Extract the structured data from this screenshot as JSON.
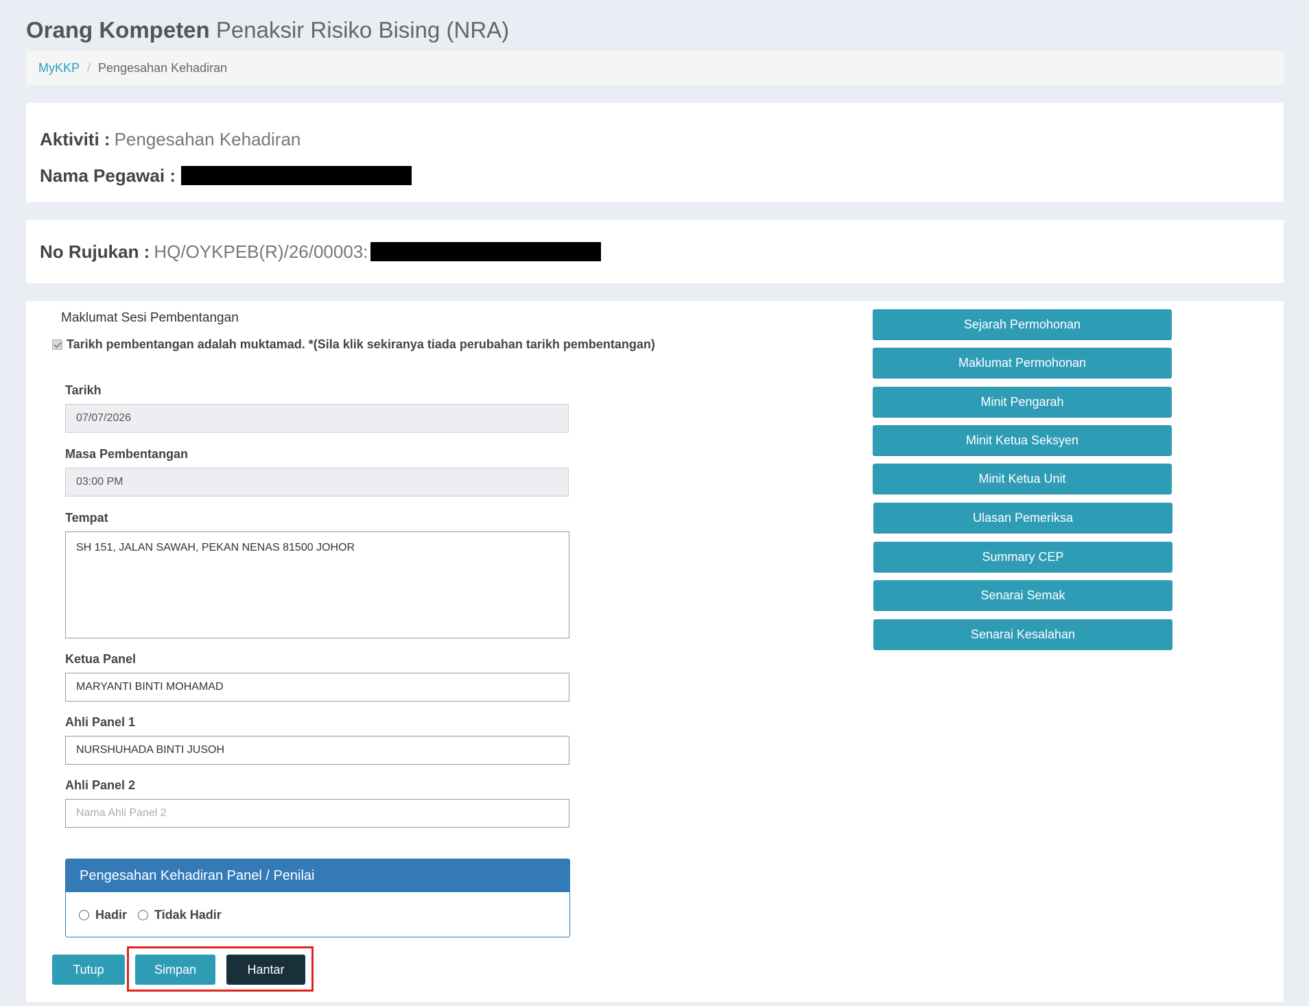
{
  "page": {
    "title_strong": "Orang Kompeten",
    "title_light": "Penaksir Risiko Bising (NRA)"
  },
  "breadcrumb": {
    "home": "MyKKP",
    "separator": "/",
    "current": "Pengesahan Kehadiran"
  },
  "activity": {
    "label": "Aktiviti :",
    "value": "Pengesahan Kehadiran",
    "officer_label": "Nama Pegawai :"
  },
  "reference": {
    "label": "No Rujukan :",
    "value": "HQ/OYKPEB(R)/26/00003:"
  },
  "session": {
    "section_title": "Maklumat Sesi Pembentangan",
    "final_checkbox_label": "Tarikh pembentangan adalah muktamad. *(Sila klik sekiranya tiada perubahan tarikh pembentangan)",
    "date_label": "Tarikh",
    "date_value": "07/07/2026",
    "time_label": "Masa Pembentangan",
    "time_value": "03:00 PM",
    "place_label": "Tempat",
    "place_value": "SH 151, JALAN SAWAH, PEKAN NENAS 81500 JOHOR",
    "chair_label": "Ketua Panel",
    "chair_value": "MARYANTI BINTI MOHAMAD",
    "member1_label": "Ahli Panel 1",
    "member1_value": "NURSHUHADA BINTI JUSOH",
    "member2_label": "Ahli Panel 2",
    "member2_placeholder": "Nama Ahli Panel 2"
  },
  "attendance": {
    "title": "Pengesahan Kehadiran Panel / Penilai",
    "present": "Hadir",
    "absent": "Tidak Hadir"
  },
  "actions": {
    "close": "Tutup",
    "save": "Simpan",
    "submit": "Hantar"
  },
  "side_menu": [
    "Sejarah Permohonan",
    "Maklumat Permohonan",
    "Minit Pengarah",
    "Minit Ketua Seksyen",
    "Minit Ketua Unit",
    "Ulasan Pemeriksa",
    "Summary CEP",
    "Senarai Semak",
    "Senarai Kesalahan"
  ],
  "colors": {
    "primary_teal": "#2f9cb6",
    "dark_button": "#18303a",
    "panel_blue": "#337ab7",
    "highlight_red": "#e2211c"
  }
}
